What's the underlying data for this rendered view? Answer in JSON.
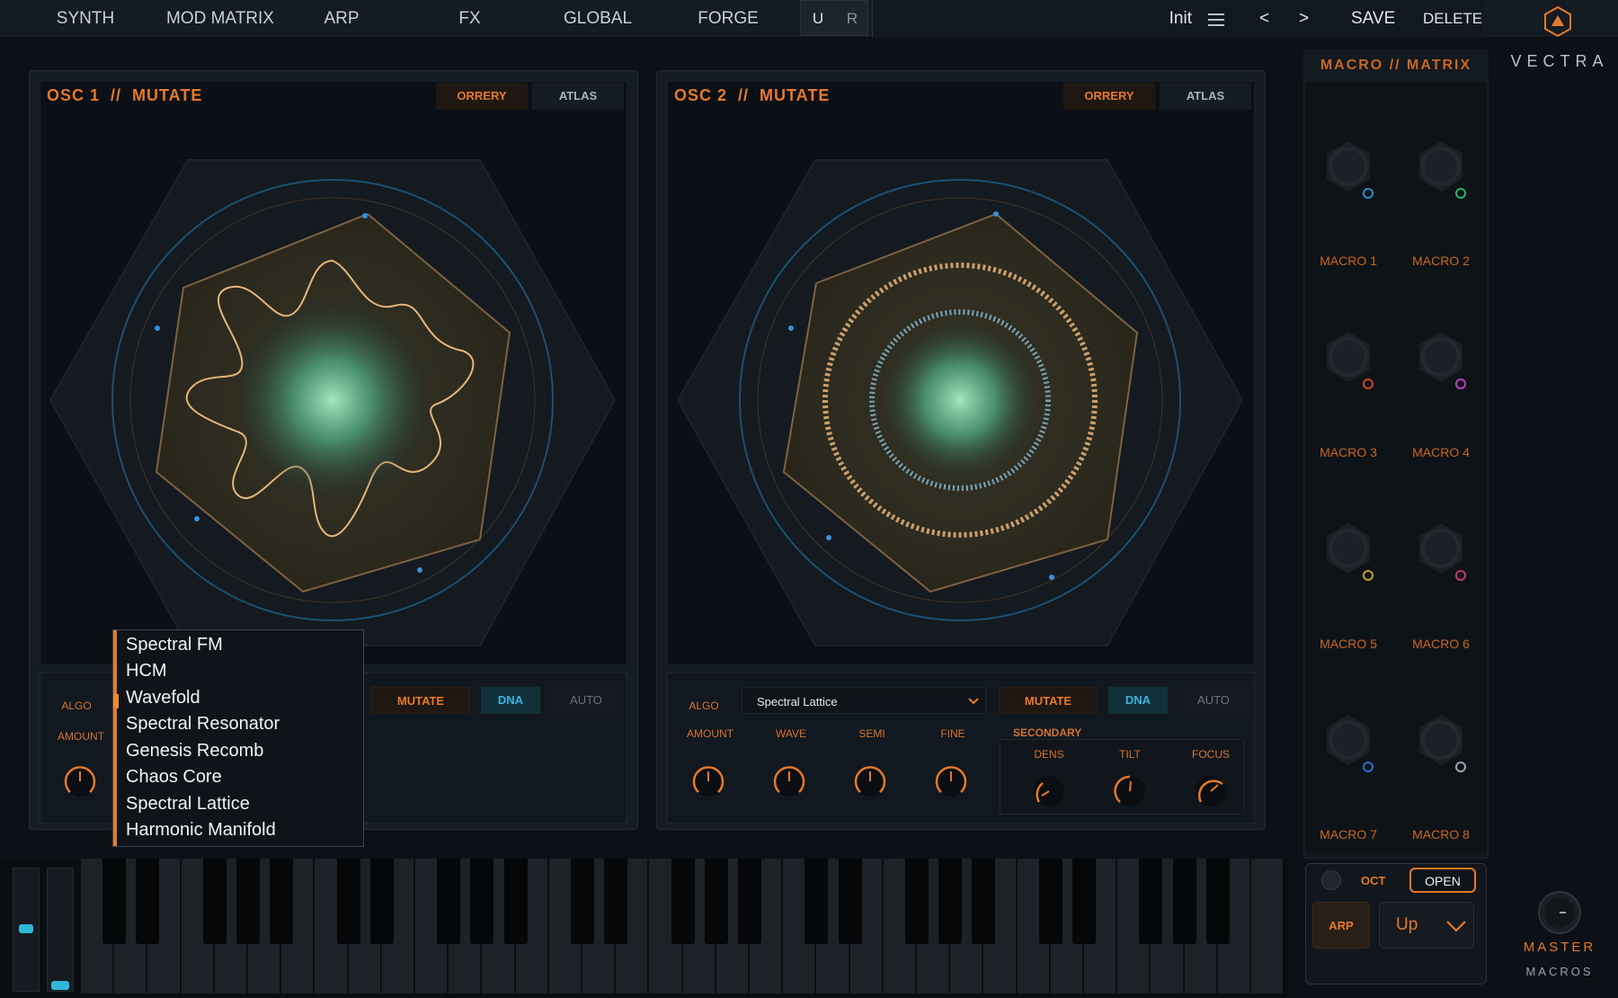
{
  "nav": {
    "tabs": [
      "SYNTH",
      "MOD MATRIX",
      "ARP",
      "FX",
      "GLOBAL",
      "FORGE"
    ],
    "undo": "U",
    "redo": "R",
    "preset_name": "Init",
    "menu_icon": "hamburger-icon",
    "prev": "<",
    "next": ">",
    "save": "SAVE",
    "delete": "DELETE"
  },
  "brand": {
    "name": "VECTRA",
    "logo_icon": "hexagon-logo-icon"
  },
  "osc1": {
    "title": "OSC 1  //  MUTATE",
    "tabs": {
      "orrery": "ORRERY",
      "atlas": "ATLAS"
    },
    "algo_label": "ALGO",
    "amount_label": "AMOUNT",
    "buttons": {
      "mutate": "MUTATE",
      "dna": "DNA",
      "auto": "AUTO"
    }
  },
  "osc2": {
    "title": "OSC 2  //  MUTATE",
    "tabs": {
      "orrery": "ORRERY",
      "atlas": "ATLAS"
    },
    "algo_label": "ALGO",
    "algo_value": "Spectral Lattice",
    "buttons": {
      "mutate": "MUTATE",
      "dna": "DNA",
      "auto": "AUTO"
    },
    "knobs": [
      "AMOUNT",
      "WAVE",
      "SEMI",
      "FINE"
    ],
    "secondary_label": "SECONDARY",
    "secondary_knobs": [
      "DENS",
      "TILT",
      "FOCUS"
    ]
  },
  "algo_dropdown": {
    "items": [
      "Spectral FM",
      "HCM",
      "Wavefold",
      "Spectral Resonator",
      "Genesis Recomb",
      "Chaos Core",
      "Spectral Lattice",
      "Harmonic Manifold"
    ],
    "highlighted": "Wavefold"
  },
  "macros": {
    "title": "MACRO // MATRIX",
    "items": [
      {
        "label": "MACRO 1",
        "color": "#2a8fc4"
      },
      {
        "label": "MACRO 2",
        "color": "#2bb36b"
      },
      {
        "label": "MACRO 3",
        "color": "#d1422f"
      },
      {
        "label": "MACRO 4",
        "color": "#b93fc4"
      },
      {
        "label": "MACRO 5",
        "color": "#c9a02a"
      },
      {
        "label": "MACRO 6",
        "color": "#c43a6b"
      },
      {
        "label": "MACRO 7",
        "color": "#2a6fc4"
      },
      {
        "label": "MACRO 8",
        "color": "#9aa3ad"
      }
    ]
  },
  "arp": {
    "oct_label": "OCT",
    "open_label": "OPEN",
    "arp_label": "ARP",
    "direction": "Up"
  },
  "master": {
    "label": "MASTER",
    "macros_tab": "MACROS"
  },
  "colors": {
    "accent": "#e7792a",
    "dna": "#39b5e0",
    "bg": "#0c1117"
  }
}
